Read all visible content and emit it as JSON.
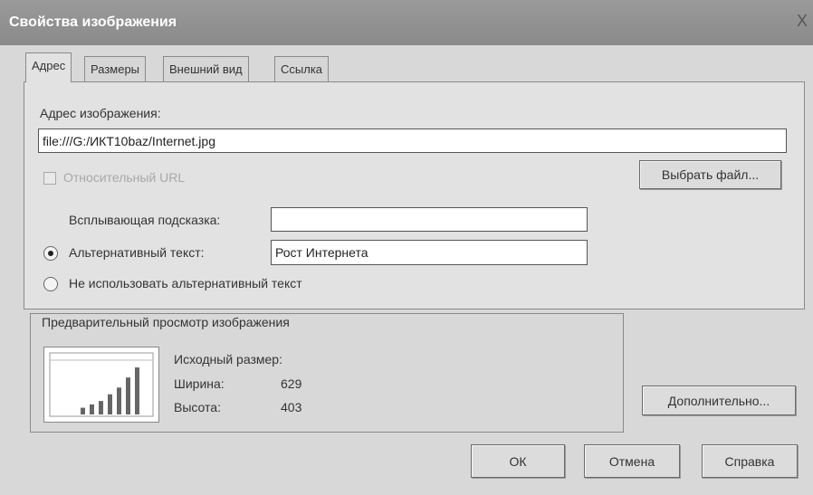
{
  "window": {
    "title": "Свойства изображения",
    "close_glyph": "X"
  },
  "tabs": [
    {
      "label": "Адрес",
      "active": true
    },
    {
      "label": "Размеры"
    },
    {
      "label": "Внешний вид"
    },
    {
      "label": "Ссылка"
    }
  ],
  "address": {
    "label": "Адрес изображения:",
    "value": "file:///G:/ИКТ10baz/Internet.jpg",
    "relative_url_label": "Относительный URL",
    "choose_file_button": "Выбрать файл..."
  },
  "tooltip": {
    "label": "Всплывающая подсказка:",
    "value": ""
  },
  "alt_text": {
    "label": "Альтернативный текст:",
    "value": "Рост Интернета",
    "selected": true
  },
  "no_alt": {
    "label": "Не использовать альтернативный текст"
  },
  "preview": {
    "title": "Предварительный просмотр изображения",
    "original_size_label": "Исходный размер:",
    "width_label": "Ширина:",
    "width_value": "629",
    "height_label": "Высота:",
    "height_value": "403",
    "thumb_bars": [
      2,
      3,
      4,
      6,
      8,
      11,
      14
    ]
  },
  "buttons": {
    "advanced": "Дополнительно...",
    "ok": "ОК",
    "cancel": "Отмена",
    "help": "Справка"
  }
}
